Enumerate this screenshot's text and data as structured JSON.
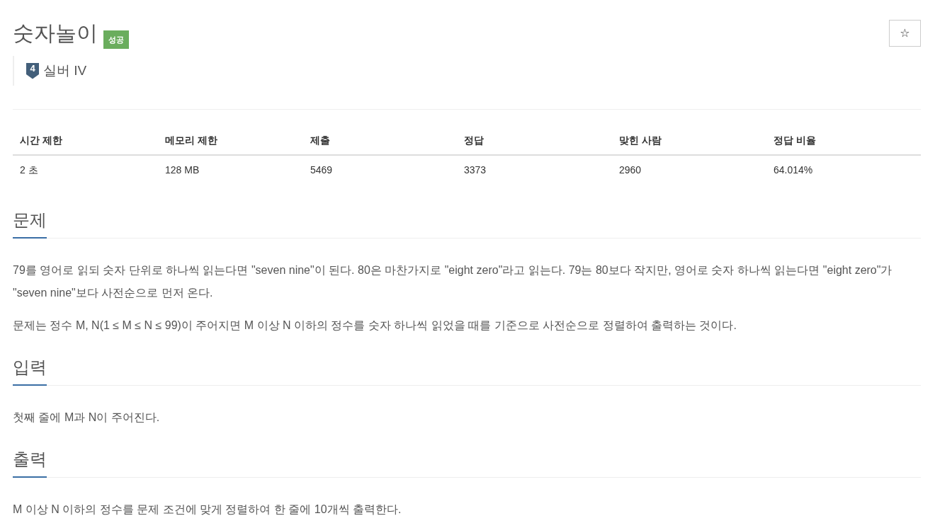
{
  "problem": {
    "title": "숫자놀이",
    "result_badge": "성공",
    "star_button": "☆",
    "tier": {
      "number": "4",
      "name": "실버 IV"
    }
  },
  "stats_table": {
    "columns": [
      "시간 제한",
      "메모리 제한",
      "제출",
      "정답",
      "맞힌 사람",
      "정답 비율"
    ],
    "rows": [
      [
        "2 초",
        "128 MB",
        "5469",
        "3373",
        "2960",
        "64.014%"
      ]
    ]
  },
  "sections": [
    {
      "heading": "문제",
      "paragraphs": [
        "79를 영어로 읽되 숫자 단위로 하나씩 읽는다면 \"seven nine\"이 된다. 80은 마찬가지로 \"eight zero\"라고 읽는다. 79는 80보다 작지만, 영어로 숫자 하나씩 읽는다면 \"eight zero\"가 \"seven nine\"보다 사전순으로 먼저 온다.",
        "문제는 정수 M, N(1 ≤ M ≤ N ≤ 99)이 주어지면 M 이상 N 이하의 정수를 숫자 하나씩 읽었을 때를 기준으로 사전순으로 정렬하여 출력하는 것이다."
      ]
    },
    {
      "heading": "입력",
      "paragraphs": [
        "첫째 줄에 M과 N이 주어진다."
      ]
    },
    {
      "heading": "출력",
      "paragraphs": [
        "M 이상 N 이하의 정수를 문제 조건에 맞게 정렬하여 한 줄에 10개씩 출력한다."
      ]
    }
  ]
}
